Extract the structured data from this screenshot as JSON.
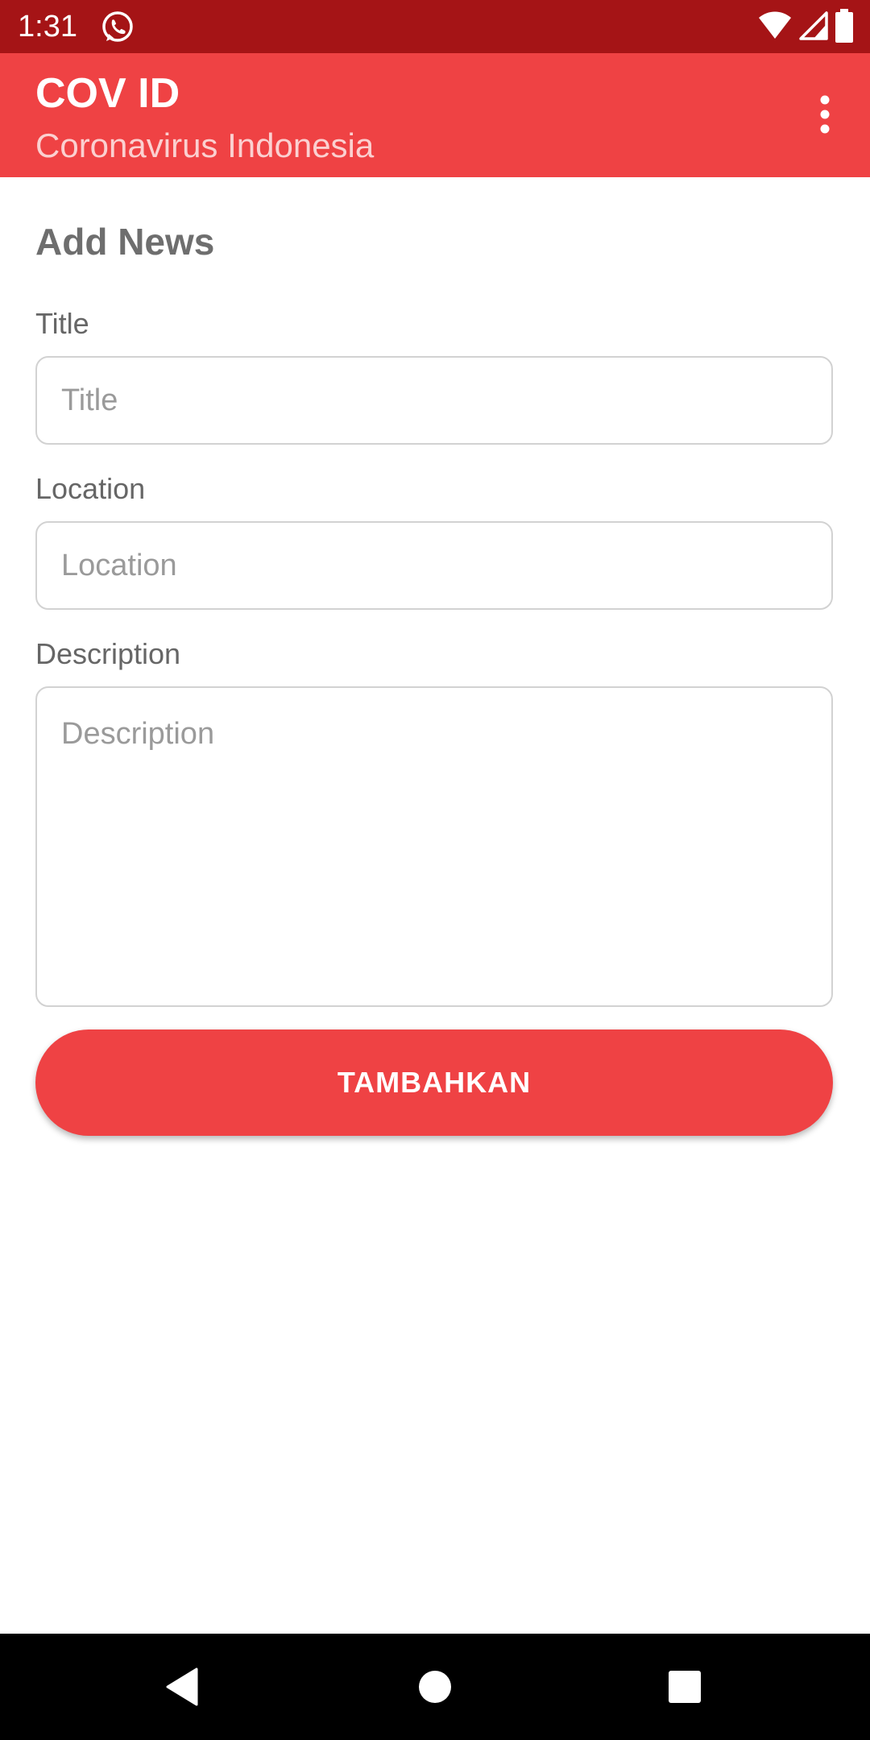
{
  "status_bar": {
    "time": "1:31",
    "icons": [
      "whatsapp-icon",
      "wifi-icon",
      "cellular-signal-icon",
      "battery-icon"
    ],
    "background": "#a51416"
  },
  "app_bar": {
    "title": "COV ID",
    "subtitle": "Coronavirus Indonesia",
    "menu_icon": "more-vert-icon",
    "background": "#ef4244"
  },
  "form": {
    "heading": "Add News",
    "title_field": {
      "label": "Title",
      "placeholder": "Title",
      "value": ""
    },
    "location_field": {
      "label": "Location",
      "placeholder": "Location",
      "value": ""
    },
    "description_field": {
      "label": "Description",
      "placeholder": "Description",
      "value": ""
    },
    "submit_label": "TAMBAHKAN",
    "accent": "#ef4244"
  },
  "nav_bar": {
    "buttons": [
      "back-icon",
      "home-icon",
      "recents-icon"
    ]
  }
}
